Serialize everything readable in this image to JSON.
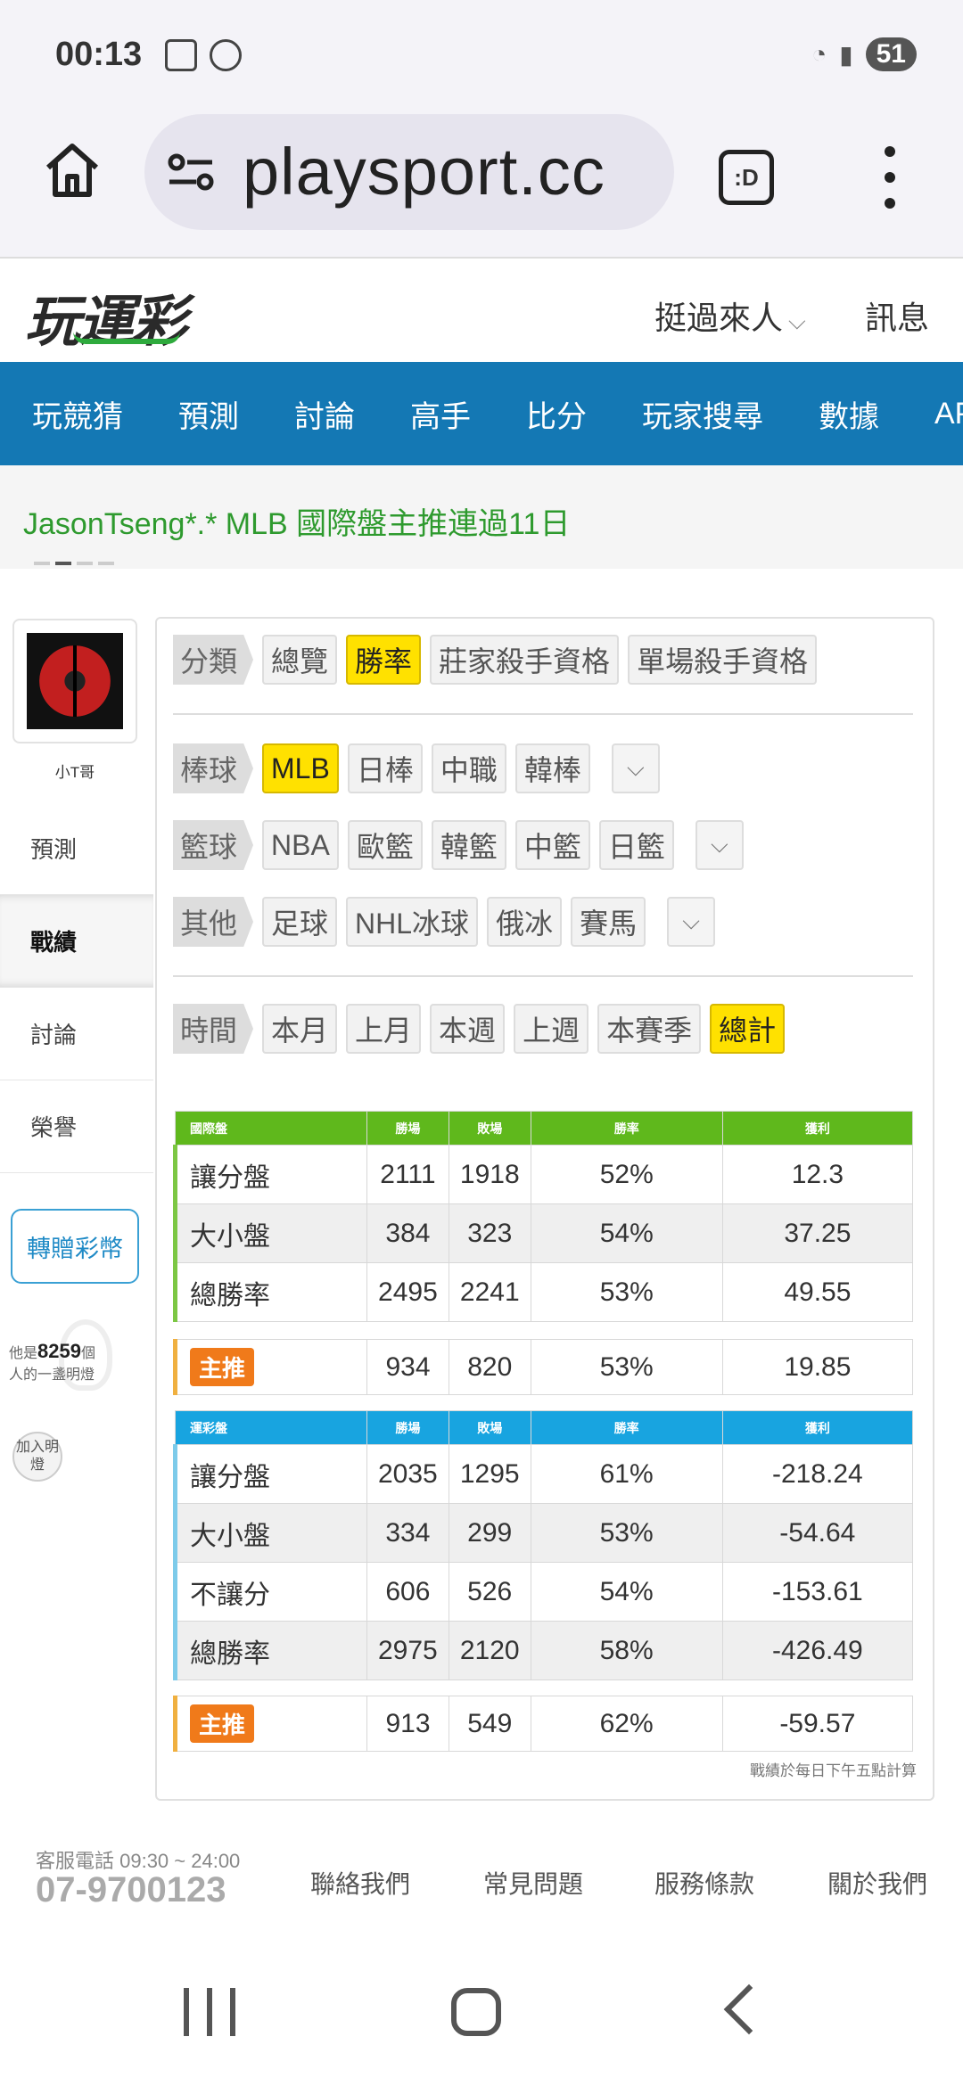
{
  "status_bar": {
    "time": "00:13",
    "battery": "51"
  },
  "browser": {
    "url": "playsport.cc",
    "tabs_label": ":D"
  },
  "site_header": {
    "logo": "玩運彩",
    "user": "挺過來人",
    "messages": "訊息"
  },
  "nav": [
    "玩競猜",
    "預測",
    "討論",
    "高手",
    "比分",
    "玩家搜尋",
    "數據",
    "APP"
  ],
  "ticker": {
    "text": "JasonTseng*.* MLB 國際盤主推連過11日"
  },
  "profile": {
    "username": "小T哥",
    "menu": [
      "預測",
      "戰績",
      "討論",
      "榮譽"
    ],
    "active_menu": "戰績",
    "gift_button": "轉贈彩幣",
    "lamp_prefix": "他是",
    "lamp_count": "8259",
    "lamp_suffix1": "個",
    "lamp_suffix2": "人的一盞明燈",
    "join_button": "加入明燈"
  },
  "filters": {
    "category": {
      "label": "分類",
      "options": [
        "總覽",
        "勝率",
        "莊家殺手資格",
        "單場殺手資格"
      ],
      "selected": "勝率"
    },
    "baseball": {
      "label": "棒球",
      "options": [
        "MLB",
        "日棒",
        "中職",
        "韓棒"
      ],
      "selected": "MLB"
    },
    "basketball": {
      "label": "籃球",
      "options": [
        "NBA",
        "歐籃",
        "韓籃",
        "中籃",
        "日籃"
      ]
    },
    "other": {
      "label": "其他",
      "options": [
        "足球",
        "NHL冰球",
        "俄冰",
        "賽馬"
      ]
    },
    "time": {
      "label": "時間",
      "options": [
        "本月",
        "上月",
        "本週",
        "上週",
        "本賽季",
        "總計"
      ],
      "selected": "總計"
    }
  },
  "intl_table": {
    "headers": [
      "國際盤",
      "勝場",
      "敗場",
      "勝率",
      "獲利"
    ],
    "rows": [
      [
        "讓分盤",
        "2111",
        "1918",
        "52%",
        "12.3"
      ],
      [
        "大小盤",
        "384",
        "323",
        "54%",
        "37.25"
      ],
      [
        "總勝率",
        "2495",
        "2241",
        "53%",
        "49.55"
      ]
    ],
    "main_pick": {
      "badge": "主推",
      "wins": "934",
      "losses": "820",
      "rate": "53%",
      "profit": "19.85"
    }
  },
  "lottery_table": {
    "headers": [
      "運彩盤",
      "勝場",
      "敗場",
      "勝率",
      "獲利"
    ],
    "rows": [
      [
        "讓分盤",
        "2035",
        "1295",
        "61%",
        "-218.24"
      ],
      [
        "大小盤",
        "334",
        "299",
        "53%",
        "-54.64"
      ],
      [
        "不讓分",
        "606",
        "526",
        "54%",
        "-153.61"
      ],
      [
        "總勝率",
        "2975",
        "2120",
        "58%",
        "-426.49"
      ]
    ],
    "main_pick": {
      "badge": "主推",
      "wins": "913",
      "losses": "549",
      "rate": "62%",
      "profit": "-59.57"
    }
  },
  "footnote": "戰績於每日下午五點計算",
  "footer": {
    "phone_label": "客服電話 09:30 ~ 24:00",
    "phone": "07-9700123",
    "links": [
      "聯絡我們",
      "常見問題",
      "服務條款",
      "關於我們"
    ]
  }
}
